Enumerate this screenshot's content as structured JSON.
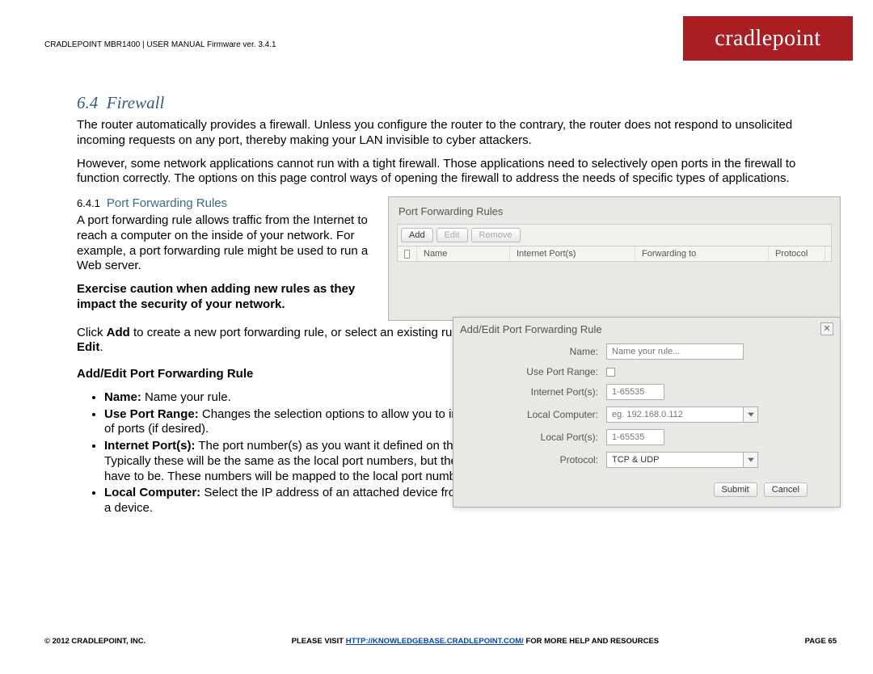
{
  "header": {
    "line": "CRADLEPOINT MBR1400 | USER MANUAL Firmware ver. 3.4.1"
  },
  "logo": {
    "text": "cradlepoint"
  },
  "section": {
    "number": "6.4",
    "title": "Firewall",
    "para1": "The router automatically provides a firewall. Unless you configure the router to the contrary, the router does not respond to unsolicited incoming requests on any port, thereby making your LAN invisible to cyber attackers.",
    "para2": "However, some network applications cannot run with a tight firewall. Those applications need to selectively open ports in the firewall to function correctly. The options on this page control ways of opening the firewall to address the needs of specific types of applications."
  },
  "subsection": {
    "number": "6.4.1",
    "title": "Port Forwarding Rules",
    "p1": "A port forwarding rule allows traffic from the Internet to reach a computer on the inside of your network. For example, a port forwarding rule might be used to run a Web server.",
    "caution": "Exercise caution when adding new rules as they impact the security of your network.",
    "p2a": "Click ",
    "p2b": "Add",
    "p2c": " to create a new port forwarding rule, or select an existing rule and click ",
    "p2d": "Edit",
    "p2e": ".",
    "addedit_heading": "Add/Edit Port Forwarding Rule",
    "bullets": {
      "b1_label": "Name:",
      "b1_text": " Name your rule.",
      "b2_label": "Use Port Range:",
      "b2_text": " Changes the selection options to allow you to input a range of ports (if desired).",
      "b3_label": "Internet Port(s):",
      "b3_text": " The port number(s) as you want it defined on the Internet. Typically these will be the same as the local port numbers, but they do not have to be. These numbers will be mapped to the local port numbers.",
      "b4_label": "Local Computer:",
      "b4_text": " Select the IP address of an attached device from the dropdown menu, or manually input the IP address of a device."
    }
  },
  "panel_rules": {
    "title": "Port Forwarding Rules",
    "add": "Add",
    "edit": "Edit",
    "remove": "Remove",
    "cols": {
      "name": "Name",
      "iports": "Internet Port(s)",
      "fwd": "Forwarding to",
      "proto": "Protocol"
    }
  },
  "dialog": {
    "title": "Add/Edit Port Forwarding Rule",
    "labels": {
      "name": "Name:",
      "useRange": "Use Port Range:",
      "iports": "Internet Port(s):",
      "local": "Local Computer:",
      "lports": "Local Port(s):",
      "proto": "Protocol:"
    },
    "placeholders": {
      "name": "Name your rule...",
      "iports": "1-65535",
      "local": "eg. 192.168.0.112",
      "lports": "1-65535"
    },
    "protocol_value": "TCP & UDP",
    "submit": "Submit",
    "cancel": "Cancel"
  },
  "footer": {
    "left": "© 2012 CRADLEPOINT, INC.",
    "center_a": "PLEASE VISIT ",
    "center_link": "HTTP://KNOWLEDGEBASE.CRADLEPOINT.COM/",
    "center_b": " FOR MORE HELP AND RESOURCES",
    "right": "PAGE 65"
  },
  "colors": {
    "brand_red": "#a91e22",
    "heading_blue": "#385a7c"
  }
}
